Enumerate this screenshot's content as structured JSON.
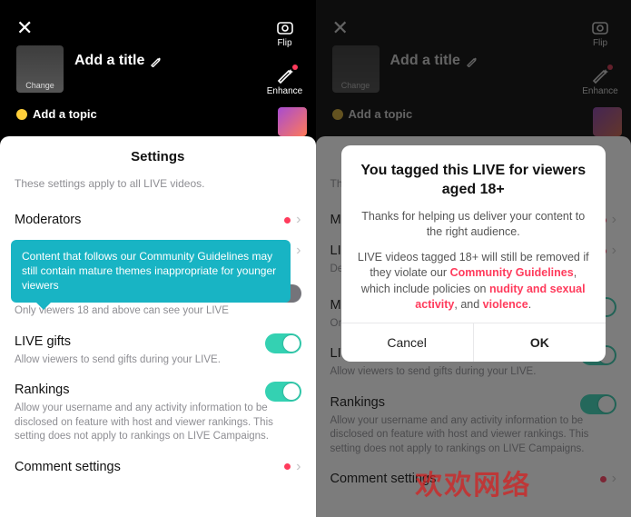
{
  "topbar": {
    "title_placeholder": "Add a title",
    "change_label": "Change",
    "topic_label": "Add a topic",
    "flip_label": "Flip",
    "enhance_label": "Enhance"
  },
  "sheet": {
    "heading": "Settings",
    "intro": "These settings apply to all LIVE videos."
  },
  "rows": {
    "moderators": {
      "label": "Moderators"
    },
    "mature": {
      "label": "Mature themes",
      "desc": "Only viewers 18 and above can see your LIVE"
    },
    "gifts": {
      "label": "LIVE gifts",
      "desc": "Allow viewers to send gifts during your LIVE."
    },
    "rankings": {
      "label": "Rankings",
      "desc": "Allow your username and any activity information to be disclosed on feature with host and viewer rankings. This setting does not apply to rankings on LIVE Campaigns."
    },
    "comments": {
      "label": "Comment settings"
    }
  },
  "tooltip": {
    "text": "Content that follows our Community Guidelines may still contain mature themes inappropriate for younger viewers"
  },
  "modal": {
    "title": "You tagged this LIVE for viewers aged 18+",
    "p1": "Thanks for helping us deliver your content to the right audience.",
    "p2a": "LIVE videos tagged 18+ will still be removed if they violate our ",
    "cg": "Community Guidelines",
    "p2b": ", which include policies on ",
    "hl1": "nudity and sexual activity",
    "and": ", and ",
    "hl2": "violence",
    "dot": ".",
    "cancel": "Cancel",
    "ok": "OK"
  },
  "watermark": "欢欢网络"
}
